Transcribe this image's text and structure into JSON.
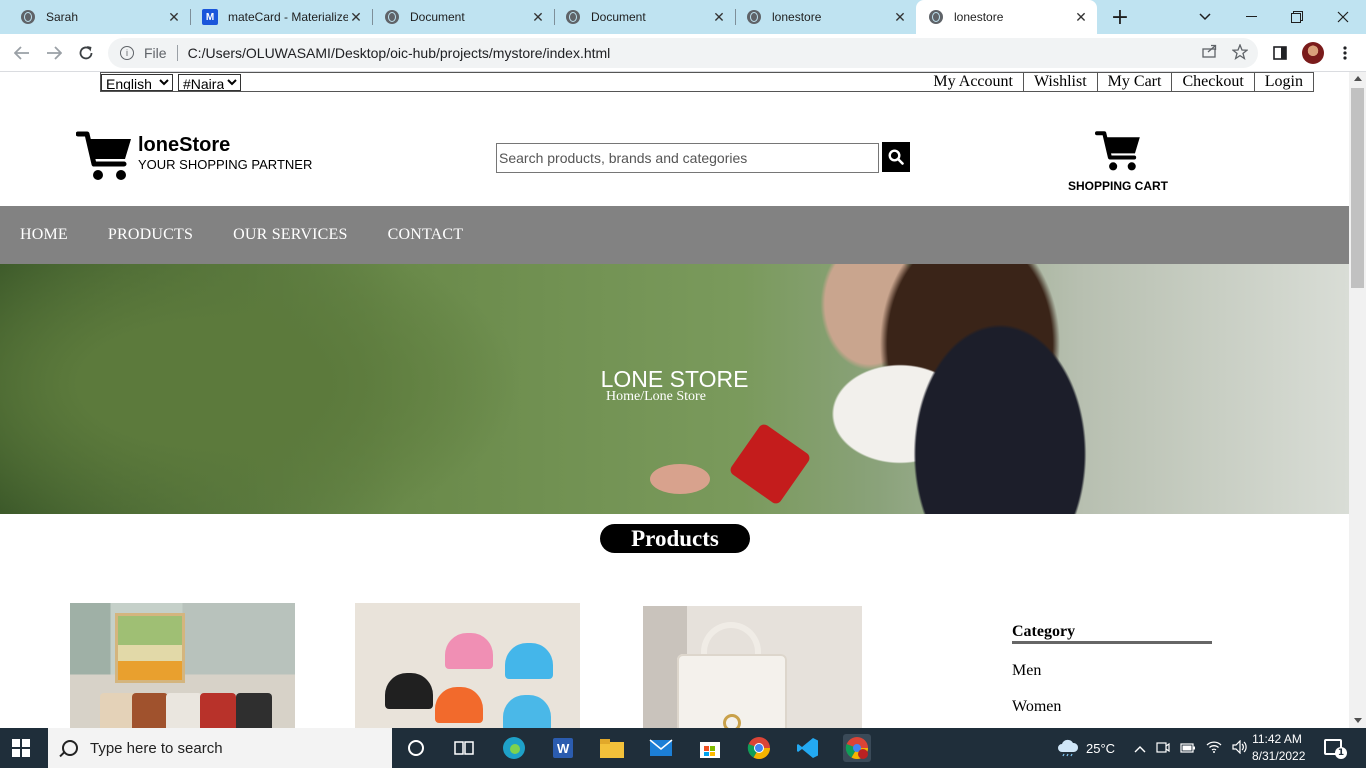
{
  "browser": {
    "tabs": [
      {
        "title": "Sarah",
        "icon": "globe-icon"
      },
      {
        "title": "mateCard - Materialize",
        "icon": "materialize-icon"
      },
      {
        "title": "Document",
        "icon": "globe-icon"
      },
      {
        "title": "Document",
        "icon": "globe-icon"
      },
      {
        "title": "lonestore",
        "icon": "globe-icon"
      },
      {
        "title": "lonestore",
        "icon": "globe-icon",
        "active": true
      }
    ],
    "address": {
      "scheme_label": "File",
      "url": "C:/Users/OLUWASAMI/Desktop/oic-hub/projects/mystore/index.html"
    }
  },
  "page": {
    "topbar": {
      "language": "English",
      "currency": "#Naira",
      "links": [
        "My Account",
        "Wishlist",
        "My Cart",
        "Checkout",
        "Login"
      ]
    },
    "brand": {
      "name": "loneStore",
      "tagline": "YOUR SHOPPING PARTNER"
    },
    "search": {
      "placeholder": "Search products, brands and categories"
    },
    "cart": {
      "label": "SHOPPING CART"
    },
    "nav": [
      "HOME",
      "PRODUCTS",
      "OUR SERVICES",
      "CONTACT"
    ],
    "hero": {
      "title": "LONE STORE",
      "breadcrumb": "Home/Lone Store"
    },
    "products_heading": "Products",
    "sidebar": {
      "title": "Category",
      "items": [
        "Men",
        "Women"
      ]
    }
  },
  "taskbar": {
    "search_placeholder": "Type here to search",
    "weather": "25°C",
    "time": "11:42 AM",
    "date": "8/31/2022"
  },
  "colors": {
    "tabbar": "#bfe3f1",
    "nav_bg": "#828282",
    "taskbar": "#1f2e3a",
    "badge": "#000000"
  }
}
